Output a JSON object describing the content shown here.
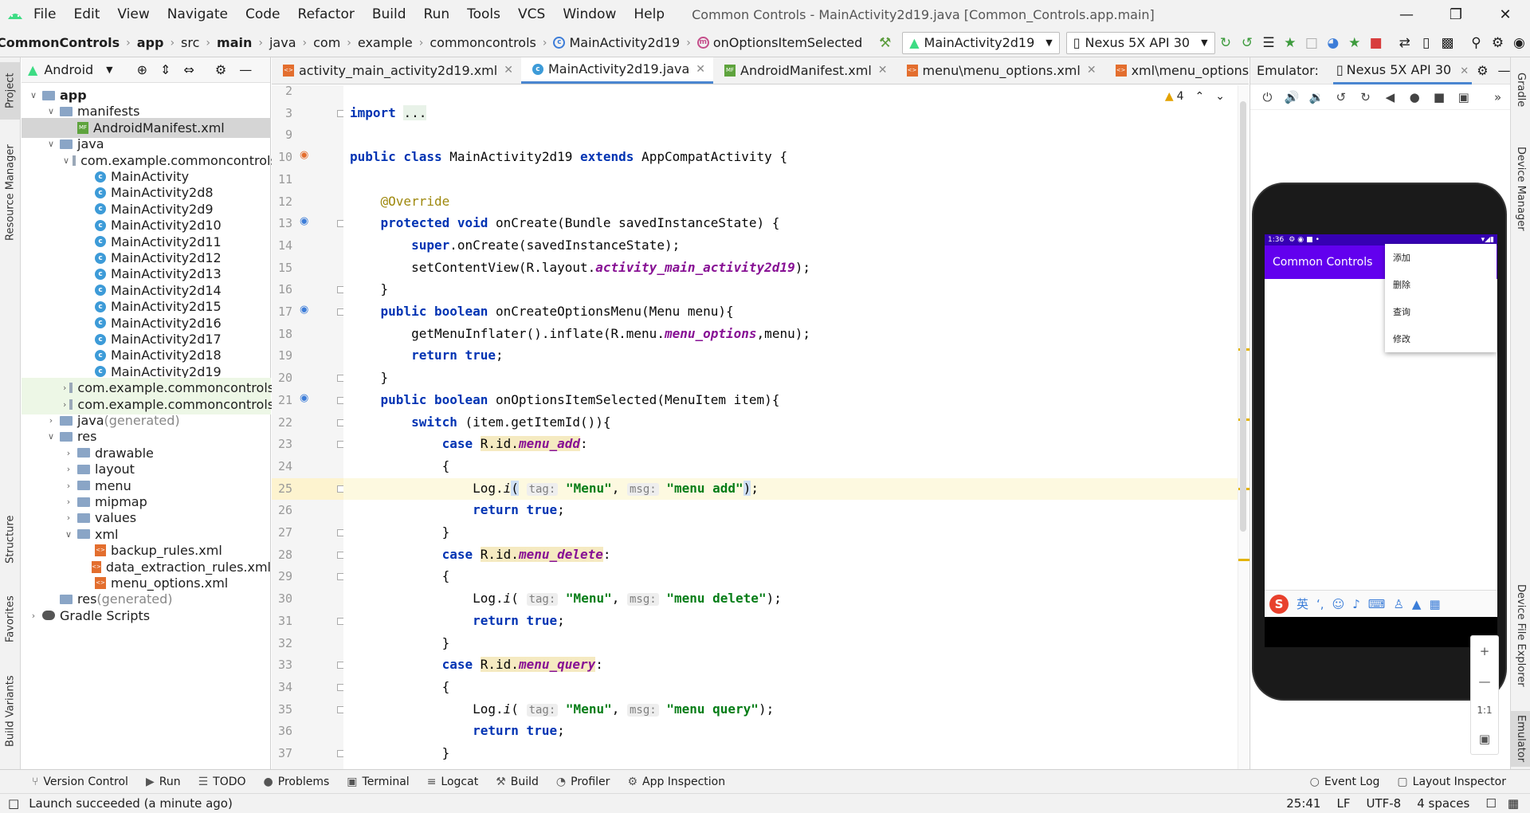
{
  "menubar": {
    "items": [
      "File",
      "Edit",
      "View",
      "Navigate",
      "Code",
      "Refactor",
      "Build",
      "Run",
      "Tools",
      "VCS",
      "Window",
      "Help"
    ],
    "window_title": "Common Controls - MainActivity2d19.java [Common_Controls.app.main]"
  },
  "navbar": {
    "breadcrumbs": [
      "CommonControls",
      "app",
      "src",
      "main",
      "java",
      "com",
      "example",
      "commoncontrols",
      "MainActivity2d19",
      "onOptionsItemSelected"
    ],
    "run_config": "MainActivity2d19",
    "device": "Nexus 5X API 30"
  },
  "left_stripe": {
    "project": "Project",
    "resource_manager": "Resource Manager",
    "structure": "Structure",
    "favorites": "Favorites",
    "build_variants": "Build Variants"
  },
  "right_stripe": {
    "gradle": "Gradle",
    "device_manager": "Device Manager",
    "device_file_explorer": "Device File Explorer",
    "emulator": "Emulator"
  },
  "project_panel": {
    "view_mode": "Android",
    "tree": [
      {
        "label": "app",
        "indent": 0,
        "arrow": "v",
        "icon": "folder",
        "bold": true
      },
      {
        "label": "manifests",
        "indent": 1,
        "arrow": "v",
        "icon": "folder"
      },
      {
        "label": "AndroidManifest.xml",
        "indent": 2,
        "arrow": "",
        "icon": "mf",
        "selected": true
      },
      {
        "label": "java",
        "indent": 1,
        "arrow": "v",
        "icon": "folder"
      },
      {
        "label": "com.example.commoncontrols",
        "indent": 2,
        "arrow": "v",
        "icon": "pkg"
      },
      {
        "label": "MainActivity",
        "indent": 3,
        "arrow": "",
        "icon": "cls"
      },
      {
        "label": "MainActivity2d8",
        "indent": 3,
        "arrow": "",
        "icon": "cls"
      },
      {
        "label": "MainActivity2d9",
        "indent": 3,
        "arrow": "",
        "icon": "cls"
      },
      {
        "label": "MainActivity2d10",
        "indent": 3,
        "arrow": "",
        "icon": "cls"
      },
      {
        "label": "MainActivity2d11",
        "indent": 3,
        "arrow": "",
        "icon": "cls"
      },
      {
        "label": "MainActivity2d12",
        "indent": 3,
        "arrow": "",
        "icon": "cls"
      },
      {
        "label": "MainActivity2d13",
        "indent": 3,
        "arrow": "",
        "icon": "cls"
      },
      {
        "label": "MainActivity2d14",
        "indent": 3,
        "arrow": "",
        "icon": "cls"
      },
      {
        "label": "MainActivity2d15",
        "indent": 3,
        "arrow": "",
        "icon": "cls"
      },
      {
        "label": "MainActivity2d16",
        "indent": 3,
        "arrow": "",
        "icon": "cls"
      },
      {
        "label": "MainActivity2d17",
        "indent": 3,
        "arrow": "",
        "icon": "cls"
      },
      {
        "label": "MainActivity2d18",
        "indent": 3,
        "arrow": "",
        "icon": "cls"
      },
      {
        "label": "MainActivity2d19",
        "indent": 3,
        "arrow": "",
        "icon": "cls"
      },
      {
        "label": "com.example.commoncontrols",
        "indent": 2,
        "arrow": ">",
        "icon": "pkg",
        "tinted": true
      },
      {
        "label": "com.example.commoncontrols",
        "indent": 2,
        "arrow": ">",
        "icon": "pkg",
        "tinted": true
      },
      {
        "label": "java",
        "suffix": " (generated)",
        "indent": 1,
        "arrow": ">",
        "icon": "folder"
      },
      {
        "label": "res",
        "indent": 1,
        "arrow": "v",
        "icon": "folder"
      },
      {
        "label": "drawable",
        "indent": 2,
        "arrow": ">",
        "icon": "folder"
      },
      {
        "label": "layout",
        "indent": 2,
        "arrow": ">",
        "icon": "folder"
      },
      {
        "label": "menu",
        "indent": 2,
        "arrow": ">",
        "icon": "folder"
      },
      {
        "label": "mipmap",
        "indent": 2,
        "arrow": ">",
        "icon": "folder"
      },
      {
        "label": "values",
        "indent": 2,
        "arrow": ">",
        "icon": "folder"
      },
      {
        "label": "xml",
        "indent": 2,
        "arrow": "v",
        "icon": "folder"
      },
      {
        "label": "backup_rules.xml",
        "indent": 3,
        "arrow": "",
        "icon": "xml"
      },
      {
        "label": "data_extraction_rules.xml",
        "indent": 3,
        "arrow": "",
        "icon": "xml"
      },
      {
        "label": "menu_options.xml",
        "indent": 3,
        "arrow": "",
        "icon": "xml"
      },
      {
        "label": "res",
        "suffix": " (generated)",
        "indent": 1,
        "arrow": "",
        "icon": "folder"
      },
      {
        "label": "Gradle Scripts",
        "indent": 0,
        "arrow": ">",
        "icon": "gradle"
      }
    ]
  },
  "editor_tabs": [
    {
      "label": "activity_main_activity2d19.xml",
      "icon": "xml"
    },
    {
      "label": "MainActivity2d19.java",
      "icon": "cls",
      "active": true
    },
    {
      "label": "AndroidManifest.xml",
      "icon": "mf"
    },
    {
      "label": "menu\\menu_options.xml",
      "icon": "xml"
    },
    {
      "label": "xml\\menu_options.xml",
      "icon": "xml"
    }
  ],
  "inspections": {
    "warnings": "4"
  },
  "code_lines": [
    {
      "n": "2",
      "html": ""
    },
    {
      "n": "3",
      "html": "<span class='kw'>import</span> <span style='background:#e8f2e8'>...</span>"
    },
    {
      "n": "9",
      "html": ""
    },
    {
      "n": "10",
      "html": "<span class='kw'>public class</span> MainActivity2d19 <span class='kw'>extends</span> AppCompatActivity {"
    },
    {
      "n": "11",
      "html": ""
    },
    {
      "n": "12",
      "html": "    <span class='ann'>@Override</span>"
    },
    {
      "n": "13",
      "html": "    <span class='kw'>protected void</span> onCreate(Bundle savedInstanceState) {"
    },
    {
      "n": "14",
      "html": "        <span class='kw'>super</span>.onCreate(savedInstanceState);"
    },
    {
      "n": "15",
      "html": "        setContentView(R.layout.<span class='fld'>activity_main_activity2d19</span>);"
    },
    {
      "n": "16",
      "html": "    }"
    },
    {
      "n": "17",
      "html": "    <span class='kw'>public boolean</span> onCreateOptionsMenu(Menu menu){"
    },
    {
      "n": "18",
      "html": "        getMenuInflater().inflate(R.menu.<span class='fld'>menu_options</span>,menu);"
    },
    {
      "n": "19",
      "html": "        <span class='kw'>return true</span>;"
    },
    {
      "n": "20",
      "html": "    }"
    },
    {
      "n": "21",
      "html": "    <span class='kw'>public boolean</span> onOptionsItemSelected(MenuItem item){"
    },
    {
      "n": "22",
      "html": "        <span class='kw'>switch</span> (item.getItemId()){"
    },
    {
      "n": "23",
      "html": "            <span class='kw'>case</span> <span class='caseh'>R.id.<span class='fld'>menu_add</span></span>:"
    },
    {
      "n": "24",
      "html": "            {"
    },
    {
      "n": "25",
      "html": "                Log.<i>i</i><span style='background:#cfe0f5'>(</span> <span class='hint'>tag:</span> <span class='str'>\"Menu\"</span>, <span class='hint'>msg:</span> <span class='str'>\"menu add\"</span><span style='background:#cfe0f5'>)</span>;",
      "current": true
    },
    {
      "n": "26",
      "html": "                <span class='kw'>return true</span>;"
    },
    {
      "n": "27",
      "html": "            }"
    },
    {
      "n": "28",
      "html": "            <span class='kw'>case</span> <span class='caseh'>R.id.<span class='fld'>menu_delete</span></span>:"
    },
    {
      "n": "29",
      "html": "            {"
    },
    {
      "n": "30",
      "html": "                Log.<i>i</i>( <span class='hint'>tag:</span> <span class='str'>\"Menu\"</span>, <span class='hint'>msg:</span> <span class='str'>\"menu delete\"</span>);"
    },
    {
      "n": "31",
      "html": "                <span class='kw'>return true</span>;"
    },
    {
      "n": "32",
      "html": "            }"
    },
    {
      "n": "33",
      "html": "            <span class='kw'>case</span> <span class='caseh'>R.id.<span class='fld'>menu_query</span></span>:"
    },
    {
      "n": "34",
      "html": "            {"
    },
    {
      "n": "35",
      "html": "                Log.<i>i</i>( <span class='hint'>tag:</span> <span class='str'>\"Menu\"</span>, <span class='hint'>msg:</span> <span class='str'>\"menu query\"</span>);"
    },
    {
      "n": "36",
      "html": "                <span class='kw'>return true</span>;"
    },
    {
      "n": "37",
      "html": "            }"
    }
  ],
  "emulator": {
    "label": "Emulator:",
    "tab": "Nexus 5X API 30",
    "status_time": "1:36",
    "app_title": "Common Controls",
    "menu_items": [
      "添加",
      "删除",
      "查询",
      "修改"
    ],
    "ime_label": "英",
    "zoom_ratio": "1:1"
  },
  "bottom_tools": [
    "Version Control",
    "Run",
    "TODO",
    "Problems",
    "Terminal",
    "Logcat",
    "Build",
    "Profiler",
    "App Inspection"
  ],
  "bottom_right_tools": [
    "Event Log",
    "Layout Inspector"
  ],
  "statusbar": {
    "message": "Launch succeeded (a minute ago)",
    "position": "25:41",
    "line_sep": "LF",
    "encoding": "UTF-8",
    "indent": "4 spaces"
  }
}
